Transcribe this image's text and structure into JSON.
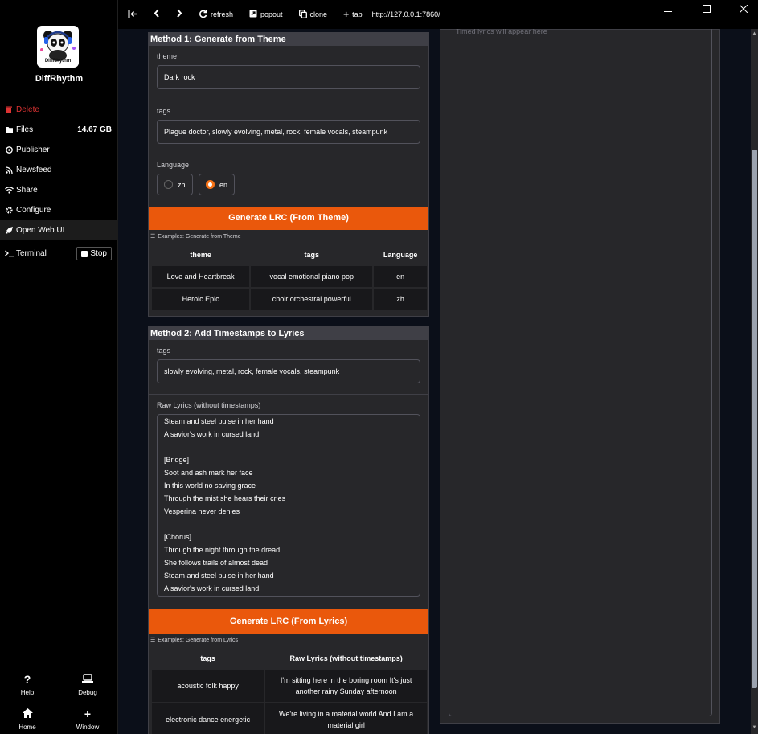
{
  "app": {
    "name": "DiffRhythm",
    "logo_text": "DiffRhythm"
  },
  "sidebar": {
    "items": [
      {
        "label": "Delete",
        "icon": "trash-icon"
      },
      {
        "label": "Files",
        "icon": "file-icon",
        "extra": "14.67 GB"
      },
      {
        "label": "Publisher",
        "icon": "publisher-icon"
      },
      {
        "label": "Newsfeed",
        "icon": "rss-icon"
      },
      {
        "label": "Share",
        "icon": "wifi-icon"
      },
      {
        "label": "Configure",
        "icon": "gear-icon"
      },
      {
        "label": "Open Web UI",
        "icon": "rocket-icon"
      },
      {
        "label": "Terminal",
        "icon": "terminal-icon",
        "button": "Stop"
      }
    ],
    "bottom": {
      "help": "Help",
      "debug": "Debug",
      "home": "Home",
      "window": "Window"
    }
  },
  "topbar": {
    "refresh": "refresh",
    "popout": "popout",
    "clone": "clone",
    "tab": "tab",
    "url": "http://127.0.0.1:7860/"
  },
  "method1": {
    "title": "Method 1: Generate from Theme",
    "theme_label": "theme",
    "theme_value": "Dark rock",
    "tags_label": "tags",
    "tags_value": "Plague doctor, slowly evolving, metal, rock, female vocals, steampunk",
    "language_label": "Language",
    "languages": [
      "zh",
      "en"
    ],
    "language_selected": "en",
    "button": "Generate LRC (From Theme)",
    "examples_label": "Examples: Generate from Theme",
    "examples": {
      "headers": [
        "theme",
        "tags",
        "Language"
      ],
      "rows": [
        [
          "Love and Heartbreak",
          "vocal emotional piano pop",
          "en"
        ],
        [
          "Heroic Epic",
          "choir orchestral powerful",
          "zh"
        ]
      ]
    }
  },
  "method2": {
    "title": "Method 2: Add Timestamps to Lyrics",
    "tags_label": "tags",
    "tags_value": "slowly evolving, metal, rock, female vocals, steampunk",
    "lyrics_label": "Raw Lyrics (without timestamps)",
    "lyrics_lines": [
      "Steam and steel pulse in her hand",
      "A savior's work in cursed land",
      "",
      "[Bridge]",
      "Soot and ash mark her face",
      "In this world no saving grace",
      "Through the mist she hears their cries",
      "Vesperina never denies",
      "",
      "[Chorus]",
      "Through the night through the dread",
      "She follows trails of almost dead",
      "Steam and steel pulse in her hand",
      "A savior's work in cursed land"
    ],
    "button": "Generate LRC (From Lyrics)",
    "examples_label": "Examples: Generate from Lyrics",
    "examples": {
      "headers": [
        "tags",
        "Raw Lyrics (without timestamps)"
      ],
      "rows": [
        [
          "acoustic folk happy",
          "I'm sitting here in the boring room It's just another rainy Sunday afternoon"
        ],
        [
          "electronic dance energetic",
          "We're living in a material world And I am a material girl"
        ]
      ]
    }
  },
  "output": {
    "placeholder": "Timed lyrics will appear here"
  }
}
